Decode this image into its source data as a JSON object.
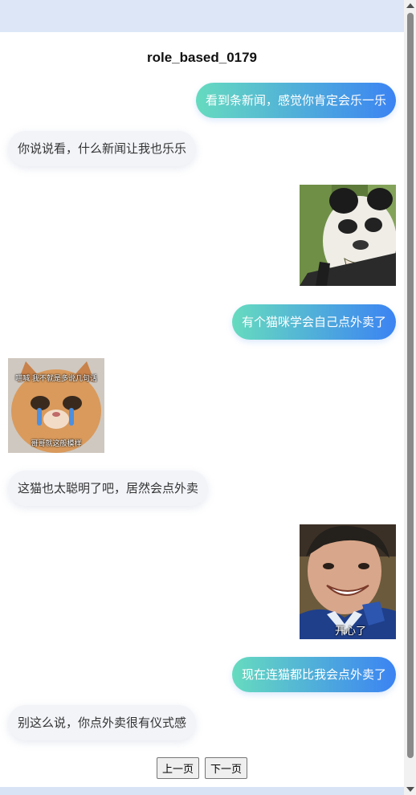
{
  "page": {
    "title": "role_based_0179"
  },
  "messages": [
    {
      "side": "right",
      "type": "text",
      "text": "看到条新闻，感觉你肯定会乐一乐"
    },
    {
      "side": "left",
      "type": "text",
      "text": "你说说看，什么新闻让我也乐乐"
    },
    {
      "side": "right",
      "type": "image",
      "icon": "panda-meme-image"
    },
    {
      "side": "right",
      "type": "text",
      "text": "有个猫咪学会自己点外卖了"
    },
    {
      "side": "left",
      "type": "image",
      "icon": "crying-cat-meme-image",
      "caption_top": "喵喊 我不就是多说几句话",
      "caption_bottom": "哥哥就这般模样"
    },
    {
      "side": "left",
      "type": "text",
      "text": "这猫也太聪明了吧，居然会点外卖"
    },
    {
      "side": "right",
      "type": "image",
      "icon": "happy-boy-meme-image",
      "caption": "开心了"
    },
    {
      "side": "right",
      "type": "text",
      "text": "现在连猫都比我会点外卖了"
    },
    {
      "side": "left",
      "type": "text",
      "text": "别这么说，你点外卖很有仪式感"
    }
  ],
  "pager": {
    "prev_label": "上一页",
    "next_label": "下一页"
  },
  "colors": {
    "bubble_right_start": "#66dbbf",
    "bubble_right_end": "#3b83f3",
    "bubble_left": "#f2f4f8"
  }
}
